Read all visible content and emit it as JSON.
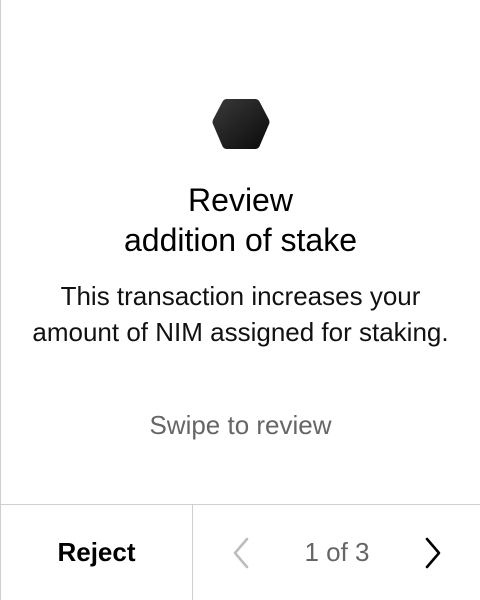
{
  "header": {
    "icon": "nimiq-hexagon-icon"
  },
  "content": {
    "title_line1": "Review",
    "title_line2": "addition of stake",
    "description": "This transaction increases your amount of NIM assigned for staking.",
    "swipe_hint": "Swipe to review"
  },
  "footer": {
    "reject_label": "Reject",
    "page_indicator": "1 of 3",
    "prev_icon": "chevron-left-icon",
    "next_icon": "chevron-right-icon"
  },
  "colors": {
    "text": "#000000",
    "muted": "#666666",
    "divider": "#cfcfcf",
    "prev_disabled": "#bdbdbd",
    "icon_dark": "#1a1a1a"
  }
}
